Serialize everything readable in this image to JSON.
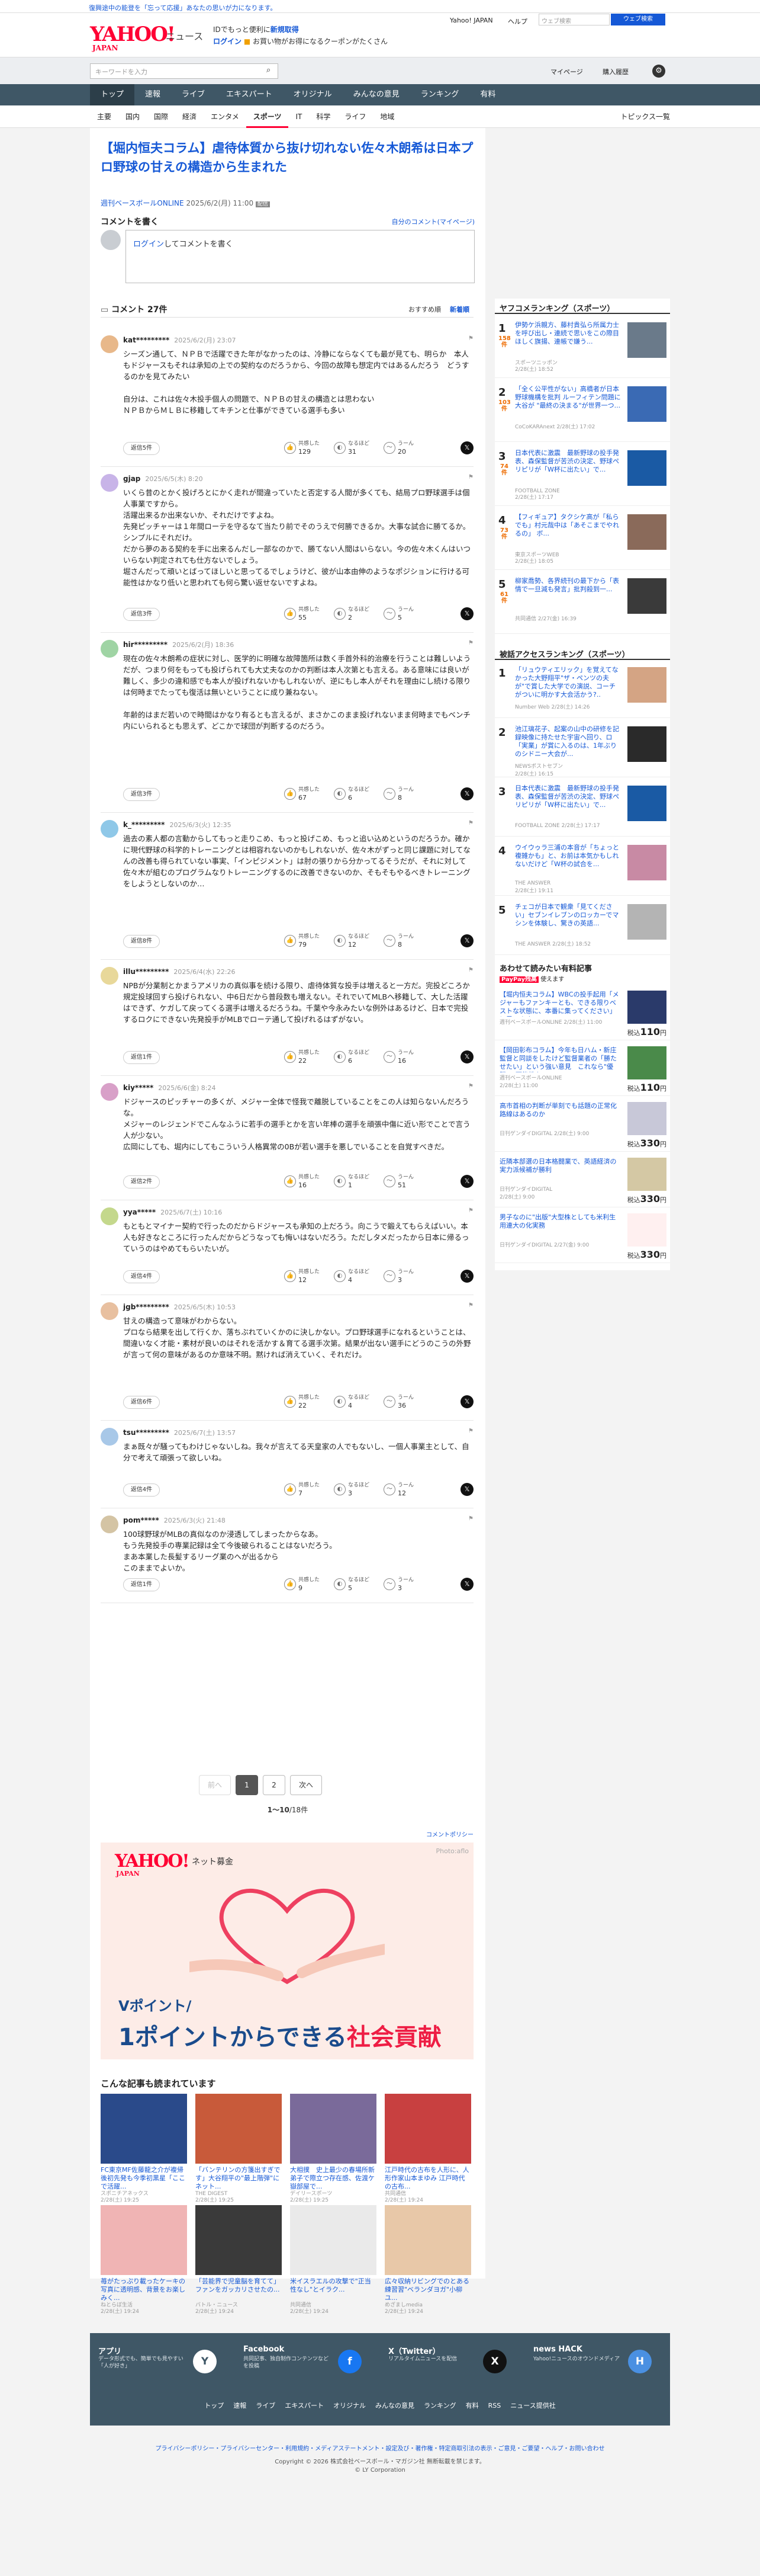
{
  "topbar": {
    "message": "復興途中の能登を「忘って応援」あなたの思いが力になります。"
  },
  "header": {
    "logo": "YAHOO!",
    "logo_sub": "JAPAN",
    "service": "ニュース",
    "promo1_pre": "IDでもっと便利に",
    "promo1_link": "新規取得",
    "promo2_link": "ログイン",
    "promo2_text": "お買い物がお得になるクーポンがたくさん",
    "top_link": "Yahoo! JAPAN",
    "help": "ヘルプ",
    "search_placeholder": "ウェブ検索",
    "search_btn": "ウェブ検索"
  },
  "searchrow": {
    "placeholder": "キーワードを入力",
    "mypage": "マイページ",
    "purchase": "購入履歴"
  },
  "nav1": [
    "トップ",
    "速報",
    "ライブ",
    "エキスパート",
    "オリジナル",
    "みんなの意見",
    "ランキング",
    "有料"
  ],
  "nav2": [
    "主要",
    "国内",
    "国際",
    "経済",
    "エンタメ",
    "スポーツ",
    "IT",
    "科学",
    "ライフ",
    "地域"
  ],
  "nav2_right": "トピックス一覧",
  "article": {
    "title": "【堀内恒夫コラム】虐待体質から抜け切れない佐々木朗希は日本プロ野球の甘えの構造から生まれた",
    "source": "週刊ベースボールONLINE",
    "date": "2025/6/2(月) 11:00",
    "label": "配信"
  },
  "comment_write": {
    "heading": "コメントを書く",
    "my_link": "自分のコメント(マイページ)",
    "login": "ログイン",
    "placeholder": "してコメントを書く"
  },
  "comment_list": {
    "heading": "コメント",
    "count": "27件",
    "sort1": "おすすめ順",
    "sort2": "新着順"
  },
  "act_labels": {
    "agree": "共感した",
    "think": "なるほど",
    "think2": "うーん"
  },
  "comments": [
    {
      "user": "kat*********",
      "date": "2025/6/2(月) 23:07",
      "body": "シーズン通して、ＮＰＢで活躍できた年がなかったのは、冷静にならなくても最が見ても、明らか　本人もドジャースもそれは承知の上での契約なのだろうから、今回の故障も想定内ではあるんだろう　どうするのかを見てみたい\n\n自分は、これは佐々木投手個人の問題で、ＮＰＢの甘えの構造とは思わない\nＮＰＢからＭＬＢに移籍してキチンと仕事ができている選手も多い",
      "replies": "返信5件",
      "agree": "129",
      "think": "31",
      "hmm": "20",
      "color": "#e8b88a"
    },
    {
      "user": "gjap",
      "date": "2025/6/5(木) 8:20",
      "body": "いくら昔のとかく投げろとにかく走れが間違っていたと否定する人間が多くても、結局プロ野球選手は個人事業ですから。\n活躍出来るか出来ないか、それだけですよね。\n先発ピッチャーは１年間ローテを守るなて当たり前でそのうえで何勝できるか。大事な試合に勝てるか。シンプルにそれだけ。\nだから夢のある契約を手に出来るんだし一部なのかで、勝てない人間はいらない。今の佐々木くんはいついらない判定されても仕方ないでしょう。\n堀さんだって頑いとばってほしいと思ってるでしょうけど、彼が山本由伸のようなポジションに行ける可能性はかなり低いと思われても何ら驚い返せないですよね。",
      "replies": "返信3件",
      "agree": "55",
      "think": "2",
      "hmm": "5",
      "color": "#c8b4e8"
    },
    {
      "user": "hir*********",
      "date": "2025/6/2(月) 18:36",
      "body": "現在の佐々木朗希の症状に対し、医学的に明確な故障箇所は数く手首外科的治療を行うことは難しいようだが、つまり何をもっても投げられても大丈夫なのかの判断は本人次第とも言える。ある意味には良いが難しく、多少の違和感でも本人が投げれないかもしれないが、逆にもし本人がそれを理由にし続ける限りは何時までたっても復活は無いということに成り兼ねない。\n\n年齢的はまだ若いので時間はかなり有るとも言えるが、まさかこのまま投げれないまま何時までもベンチ内にいられるとも思えず、どこかで球団が判断するのだろう。",
      "replies": "返信3件",
      "agree": "67",
      "think": "6",
      "hmm": "8",
      "color": "#9fd4a4"
    },
    {
      "user": "k_*********",
      "date": "2025/6/3(火) 12:35",
      "body": "過去の素人都の言動からしてもっと走りこめ、もっと投げこめ、もっと追い込めというのだろうか。確かに現代野球の科学的トレーニングとは相容れないのかもしれないが、佐々木がずっと同じ課題に対してなんの改善も得られていない事実、「インピジメント」は肘の張りから分かってるそうだが、それに対して佐々木が組むのプログラムなりトレーニングするのに改善できないのか、そもそもやるべきトレーニングをしようとしないのか…",
      "replies": "返信8件",
      "agree": "79",
      "think": "12",
      "hmm": "8",
      "color": "#8fc8e8"
    },
    {
      "user": "illu*********",
      "date": "2025/6/4(水) 22:26",
      "body": "NPBが分業制とかまうアメリカの真似事を続ける限り、虐待体質な投手は増えると一方だ。完投どころか規定投球回すら投げられない、中6日だから普段数も増えない。それでいてMLBへ移籍して、大した活躍はできず、ケガして戻ってくる選手は増えるだろうね。千葉や今永みたいな例外はあるけど、日本で完投するロクにできない先発投手がMLBでローテ通して投げれるはずがない。",
      "replies": "返信1件",
      "agree": "22",
      "think": "6",
      "hmm": "16",
      "color": "#e8d89a"
    },
    {
      "user": "kiy*****",
      "date": "2025/6/6(金) 8:24",
      "body": "ドジャースのピッチャーの多くが、メジャー全体で怪我で離脱していることをこの人は知らないんだろうな。\nメジャーのレジェンドでこんなふうに若手の選手とかを言い年棒の選手を頑張中傷に近い形でことで言う人が少ない。\n広岡にしても、堀内にしてもこういう人格異常の0Bが若い選手を悪しでいることを自覚すべきだ。",
      "replies": "返信2件",
      "agree": "16",
      "think": "1",
      "hmm": "51",
      "color": "#d8a0c8"
    },
    {
      "user": "yya*****",
      "date": "2025/6/7(土) 10:16",
      "body": "もともとマイナー契約で行ったのだからドジャースも承知の上だろう。向こうで鍛えてもらえばいい。本人も好きなところに行ったんだからどうなっても悔いはないだろう。ただしタメだったから日本に帰るっていうのはやめてもらいたいが。",
      "replies": "返信4件",
      "agree": "12",
      "think": "4",
      "hmm": "3",
      "color": "#c4d88c"
    },
    {
      "user": "jgb*********",
      "date": "2025/6/5(木) 10:53",
      "body": "甘えの構造って意味がわからない。\nプロなら結果を出して行くか、落ちぶれていくかのに決しかない。プロ野球選手になれるということは、間違いなく才能・素材が良いのはそれを活かす＆育てる選手次第。結果が出ない選手にどうのこうの外野が言って何の意味があるのか意味不明。黙ければ消えていく、それだけ。",
      "replies": "返信6件",
      "agree": "22",
      "think": "4",
      "hmm": "36",
      "color": "#e8c0a0"
    },
    {
      "user": "tsu*********",
      "date": "2025/6/7(土) 13:57",
      "body": "まぁ既々が騒ってもわけじゃないしね。我々が言えてる天皇家の人でもないし、一個人事業主として、自分で考えて頑張って欲しいね。",
      "replies": "返信4件",
      "agree": "7",
      "think": "3",
      "hmm": "12",
      "color": "#a8c8e8"
    },
    {
      "user": "pom*****",
      "date": "2025/6/3(火) 21:48",
      "body": "100球野球がMLBの真似なのか浸透してしまったからなあ。\nもう先発投手の専業記録は全て今後破られることはないだろう。\nまあ本業した長髪するリーグ業のへが出るから\nこのままでよいか。",
      "replies": "返信1件",
      "agree": "9",
      "think": "5",
      "hmm": "3",
      "color": "#d4c4a4"
    }
  ],
  "pager": {
    "prev": "前へ",
    "p1": "1",
    "p2": "2",
    "next": "次へ",
    "count_pre": "1〜10",
    "count_post": "件",
    "total": "18"
  },
  "policy": "コメントポリシー",
  "ad": {
    "logo": "YAHOO!",
    "logo_sub": "JAPAN",
    "kikin": "ネット募金",
    "photo": "Photo:aflo",
    "sub": "Vポイント/",
    "main1": "1ポイントからできる",
    "main2": "社会貢献"
  },
  "related": {
    "heading": "こんな記事も読まれています",
    "items": [
      {
        "title": "FC東京MF佐藤龍之介が複帰後初先発も今季初黒星「ここで活躍...",
        "meta": "スポニチアネックス\n2/28(土) 19:25",
        "color": "#2a4a8a"
      },
      {
        "title": "「バンテリンの方箋出すぎです」大谷翔平の\"最上階弾\"にネット...",
        "meta": "THE DIGEST\n2/28(土) 19:25",
        "color": "#c85a3a"
      },
      {
        "title": "大相撲　史上最少の春場所新弟子で際立つ存在感、佐渡ケ嶽部屋で...",
        "meta": "デイリースポーツ\n2/28(土) 19:25",
        "color": "#7a6a9a"
      },
      {
        "title": "江戸時代の古布を人形に、人形作家山本まゆみ 江戸時代の古布...",
        "meta": "共同通信\n2/28(土) 19:24",
        "color": "#c84040"
      },
      {
        "title": "苺がたっぷり載ったケーキの写真に透明感、背景をお楽しみく...",
        "meta": "ねとらぼ生活\n2/28(土) 19:24",
        "color": "#f0b4b4"
      },
      {
        "title": "「芸能界で児童脳を育てて」ファンをガッカリさせたの...",
        "meta": "バトル・ニュース\n2/28(土) 19:24",
        "color": "#3a3a3a"
      },
      {
        "title": "米イスラエルの攻撃で\"正当性なし\"とイラク...",
        "meta": "共同通信\n2/28(土) 19:24",
        "color": "#eaeaea"
      },
      {
        "title": "広々収納リビングでのとある練習習\"ベランダヨガ\"小柳ユ...",
        "meta": "めざましmedia\n2/28(土) 19:24",
        "color": "#e8c8a8"
      }
    ]
  },
  "ranking1": {
    "heading": "ヤフコメランキング（スポーツ）",
    "items": [
      {
        "no": "1",
        "badge": "158件",
        "title": "伊勢ケ浜親方、藤村貴弘ら所属力士を呼び出し・連続で思いをこの際目ほしく旗揚、連帳で嫌う... ",
        "meta": "スポーツニッポン\n2/28(土) 18:52",
        "color": "#6a7a8a"
      },
      {
        "no": "2",
        "badge": "103件",
        "title": "「全く公平性がない」高橋者が日本野球機構を批判 ルーフィテン問題に大谷が \"最終の決まる\"が世界一つ...",
        "meta": "CoCoKARAnext 2/28(土) 17:02",
        "color": "#3a6ab4"
      },
      {
        "no": "3",
        "badge": "74件",
        "title": "日本代表に激震　最新野球の投手発表、森保監督が苦渋の決定、野球ペリピリが「W杯に出たい」で...",
        "meta": "FOOTBALL ZONE\n2/28(土) 17:17",
        "color": "#1a5aa4"
      },
      {
        "no": "4",
        "badge": "73件",
        "title": "【フィギュア】タクシケ高が「私らでも」村元哉中は「あそこまでやれるの」 ボ...",
        "meta": "東京スポーツWEB\n2/28(土) 18:05",
        "color": "#8a6a5a"
      },
      {
        "no": "5",
        "badge": "61件",
        "title": "柳家喬勢、各界続刊の最下から「表情で一旦減も発言」批判殺到一...",
        "meta": "共同通信 2/27(金) 16:39",
        "color": "#3a3a3a"
      }
    ]
  },
  "ranking2": {
    "heading": "被話アクセスランキング（スポーツ）",
    "items": [
      {
        "no": "1",
        "title": "「リュウティエリック」を覚えてなかった大野翔平\"ザ・ペンツの夫が\"で賞した大学での演説、コーチがついに明かす大会活かう?..",
        "meta": "Number Web 2/28(土) 14:26",
        "color": "#d4a484"
      },
      {
        "no": "2",
        "title": "池江璃花子、起案の山中の研修を記録映像に持たせた宇宙ヘ回り、ロ「実業」が賞に入るのは、1年ぶりのシドニー大会が...",
        "meta": "NEWSポストセブン\n2/28(土) 16:15",
        "color": "#2a2a2a"
      },
      {
        "no": "3",
        "title": "日本代表に激震　最新野球の投手発表、森保監督が苦渋の決定、野球ペリピリが「W杯に出たい」で...",
        "meta": "FOOTBALL ZONE 2/28(土) 17:17",
        "color": "#1a5aa4"
      },
      {
        "no": "4",
        "title": "ウイウゥラ三浦の本音が「ちょっと複雑かも」と、お前は本気かもしれないだけど「W杯の試合を...",
        "meta": "THE ANSWER\n2/28(土) 19:11",
        "color": "#c88aa4"
      },
      {
        "no": "5",
        "title": "チェコが日本で観衆「見てください」セブンイレブンのロッカーでマシンを体験し、驚きの英語...",
        "meta": "THE ANSWER 2/28(土) 18:52",
        "color": "#b4b4b4"
      }
    ]
  },
  "shop": {
    "heading": "あわせて読みたい有料記事",
    "badge": "PayPay残高",
    "badge_suffix": "使えます",
    "currency": "円",
    "tax": "税込",
    "items": [
      {
        "title": "【堀内恒夫コラム】WBCの投手起用「メジャーもファンキーとも、できる限りベストな状態に、本番に集ってください」に思います」",
        "meta": "週刊ベースボールONLINE 2/28(土) 11:00",
        "price": "110",
        "color": "#2a3a6a"
      },
      {
        "title": "【岡田彰布コラム】今年も日ハム・新庄監督と同談をしたけど監督業者の「勝たせたい」という強い意見　これなら\"優勝\"の可能性も",
        "meta": "週刊ベースボールONLINE\n2/28(土) 11:00",
        "price": "110",
        "color": "#4a8a4a"
      },
      {
        "title": "高市首相の判断が単刻でも話題の正常化路線はあるのか",
        "meta": "日刊ゲンダイDIGITAL 2/28(土) 9:00",
        "price": "330",
        "color": "#c8c8d8"
      },
      {
        "title": "近隣本部選の日本格闘業で、英語経済の実力派候補が勝利",
        "meta": "日刊ゲンダイDIGITAL\n2/28(土) 9:00",
        "price": "330",
        "color": "#d4c8a4"
      },
      {
        "title": "男子なのに\"出版\"大型株としても米利生用連大の化実務",
        "meta": "日刊ゲンダイDIGITAL 2/27(金) 9:00",
        "price": "330",
        "color": "#fff0f0"
      }
    ]
  },
  "footer": {
    "apps": [
      {
        "name": "アプリ",
        "desc": "データ形式でも、簡単でも見やすい\n「人が好き」",
        "icon": "Y",
        "color": "#ffffff",
        "fg": "#3f5766"
      },
      {
        "name": "Facebook",
        "desc": "共同記事、独自制作コンテンツなどを投稿",
        "icon": "f",
        "color": "#1877f2",
        "fg": "#ffffff"
      },
      {
        "name": "X（Twitter）",
        "desc": "リアルタイムニュースを配信",
        "icon": "X",
        "color": "#111111",
        "fg": "#ffffff"
      },
      {
        "name": "news HACK",
        "desc": "Yahoo!ニュースのオウンドメディア",
        "icon": "H",
        "color": "#4a90e2",
        "fg": "#ffffff"
      }
    ],
    "links": [
      "トップ",
      "速報",
      "ライブ",
      "エキスパート",
      "オリジナル",
      "みんなの意見",
      "ランキング",
      "有料",
      "RSS",
      "ニュース提供社"
    ],
    "legal": "プライバシーポリシー・プライバシーセンター・利用規約・メディアステートメント・設定及び・著作権・特定商取引法の表示・ご意見・ご要望・ヘルプ・お問い合わせ",
    "copyright": "Copyright © 2026 株式会社ベースボール・マガジン社 無断転載を禁じます。",
    "copyright2": "© LY Corporation"
  },
  "colors": {
    "brand": "#ff0033",
    "link": "#1558d6",
    "nav": "#3f5766"
  }
}
